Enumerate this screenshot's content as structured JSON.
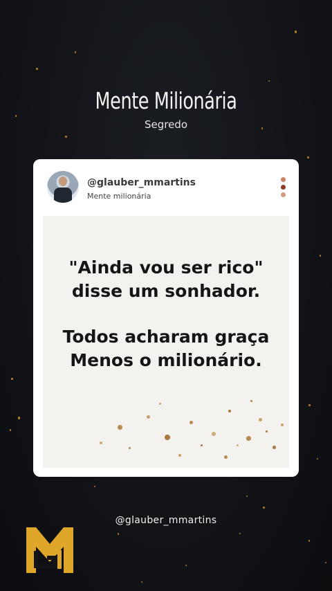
{
  "header": {
    "title": "Mente Milionária",
    "subtitle": "Segredo"
  },
  "post": {
    "handle": "@glauber_mmartins",
    "bio": "Mente milionária",
    "menu_icon": "vertical-dots-icon",
    "quote_lines": [
      "\"Ainda vou ser rico\"",
      "disse um sonhador.",
      "Todos acharam graça",
      "Menos o milionário."
    ]
  },
  "footer": {
    "handle": "@glauber_mmartins"
  },
  "logo": {
    "icon": "gm-monogram-logo",
    "color": "#e0a62a"
  },
  "colors": {
    "background": "#121418",
    "spark": "#c98a2a",
    "dot_top": "#c98466",
    "dot_mid": "#8c3d24",
    "dot_bottom": "#d49a7e"
  }
}
